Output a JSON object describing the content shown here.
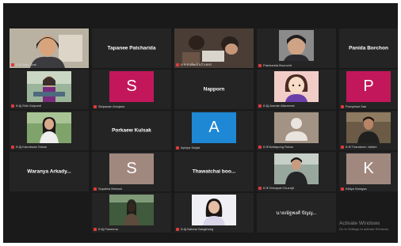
{
  "participants": [
    {
      "id": "p1",
      "name": "",
      "caption": "ด.ญ.Jelly Chai",
      "type": "video"
    },
    {
      "id": "p2",
      "name": "Tapanee Patcharida",
      "caption": "",
      "type": "name"
    },
    {
      "id": "p3",
      "name": "",
      "caption": "ด.ช.ดนพัฒน์ แก้วเพชร",
      "type": "video"
    },
    {
      "id": "p4",
      "name": "",
      "caption": "Patcharida Boonchit",
      "type": "video"
    },
    {
      "id": "p5",
      "name": "Panida Borchon",
      "caption": "",
      "type": "name"
    },
    {
      "id": "p6",
      "name": "",
      "caption": "ด.ญ.Sirin Kulpanit",
      "type": "video"
    },
    {
      "id": "p7",
      "name": "S",
      "caption": "Siripawan Kanjana",
      "type": "letter",
      "color": "#c2185b"
    },
    {
      "id": "p8",
      "name": "Napporn",
      "caption": "",
      "type": "name"
    },
    {
      "id": "p9",
      "name": "",
      "caption": "ด.ญ.Aomsin Maneerat",
      "type": "avatar"
    },
    {
      "id": "p10",
      "name": "P",
      "caption": "Pornpimol Sae",
      "type": "letter",
      "color": "#c2185b"
    },
    {
      "id": "p11",
      "name": "",
      "caption": "ด.ญ.Kanokwan Srisuk",
      "type": "video"
    },
    {
      "id": "p12",
      "name": "Porkaew Kulsak",
      "caption": "",
      "type": "name"
    },
    {
      "id": "p13",
      "name": "A",
      "caption": "Apinya Sukjai",
      "type": "letter",
      "color": "#1e88d4"
    },
    {
      "id": "p14",
      "name": "",
      "caption": "ด.ช.Nattapong Ruksa",
      "type": "silhouette"
    },
    {
      "id": "p15",
      "name": "",
      "caption": "ด.ช.Thanakorn Jaidee",
      "type": "video"
    },
    {
      "id": "p16",
      "name": "Waranya Arkady...",
      "caption": "",
      "type": "name"
    },
    {
      "id": "p17",
      "name": "S",
      "caption": "Supattra Meesuk",
      "type": "letter",
      "color": "#a1887f"
    },
    {
      "id": "p18",
      "name": "Thawatchai boo...",
      "caption": "",
      "type": "name"
    },
    {
      "id": "p19",
      "name": "",
      "caption": "ด.ช.Teerapat Chuenjit",
      "type": "video"
    },
    {
      "id": "p20",
      "name": "K",
      "caption": "Kittiya Wongsa",
      "type": "letter",
      "color": "#a1887f"
    },
    {
      "id": "p21",
      "name": "",
      "caption": "ด.ญ.Paweena",
      "type": "video"
    },
    {
      "id": "p22",
      "name": "",
      "caption": "ด.ญ.Natcha Sangthong",
      "type": "video"
    },
    {
      "id": "p23",
      "name": "นายณัฐพงศ์ ปัญญ...",
      "caption": "",
      "type": "name"
    }
  ],
  "watermark": {
    "line1": "Activate Windows",
    "line2": "Go to Settings to activate Windows."
  }
}
